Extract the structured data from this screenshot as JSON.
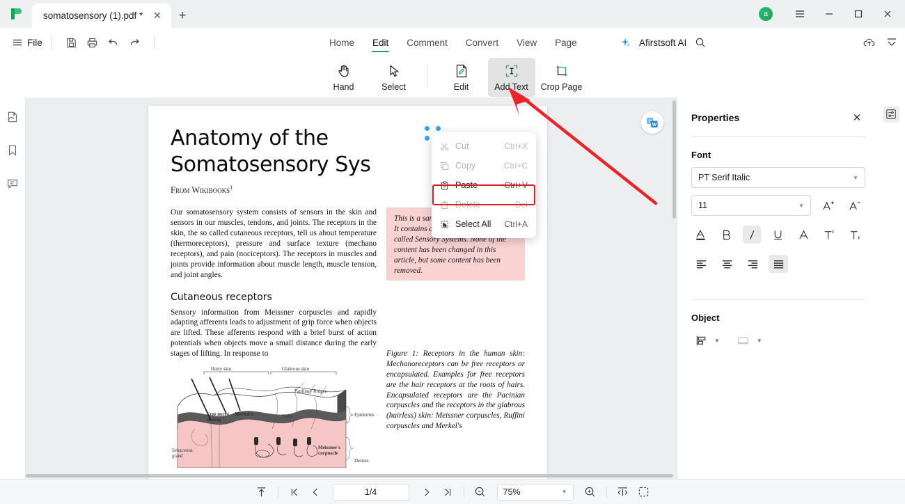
{
  "titlebar": {
    "tab_title": "somatosensory (1).pdf *",
    "close_label": "✕",
    "new_tab_label": "+",
    "avatar_initial": "a",
    "menu_label": "☰",
    "minimize_label": "—",
    "maximize_label": "☐",
    "close_window_label": "✕"
  },
  "ribbon": {
    "file_label": "File",
    "quick_actions": [
      "save-icon",
      "print-icon",
      "undo-icon",
      "redo-icon"
    ],
    "tabs": [
      {
        "label": "Home",
        "active": false
      },
      {
        "label": "Edit",
        "active": true
      },
      {
        "label": "Comment",
        "active": false
      },
      {
        "label": "Convert",
        "active": false
      },
      {
        "label": "View",
        "active": false
      },
      {
        "label": "Page",
        "active": false
      }
    ],
    "ai_label": "Afirstsoft AI",
    "tools": [
      {
        "label": "Hand",
        "icon": "hand-icon",
        "selected": false
      },
      {
        "label": "Select",
        "icon": "cursor-icon",
        "selected": false
      },
      {
        "label": "Edit",
        "icon": "edit-page-icon",
        "selected": false
      },
      {
        "label": "Add Text",
        "icon": "add-text-icon",
        "selected": true
      },
      {
        "label": "Crop Page",
        "icon": "crop-page-icon",
        "selected": false
      }
    ]
  },
  "left_rail": [
    {
      "name": "thumbnails-icon"
    },
    {
      "name": "bookmark-icon"
    },
    {
      "name": "comment-icon"
    }
  ],
  "document": {
    "title_line1": "Anatomy of the",
    "title_line2": "Somatosensory Sys",
    "from_label": "From Wikibooks",
    "from_sup": "1",
    "paragraph1": "Our somatosensory system consists of sensors in the skin and sensors in our muscles, tendons, and joints. The receptors in the skin, the so called cutaneous receptors, tell us about temperature (thermoreceptors), pressure and surface texture (mechano receptors), and pain (nociceptors). The receptors in muscles and joints provide information about muscle length, muscle tension, and joint angles.",
    "section_heading": "Cutaneous receptors",
    "paragraph2": "Sensory information from Meissner corpuscles and rapidly adapting afferents leads to adjustment of grip force when objects are lifted. These afferents respond with a brief burst of action potentials when objects move a small distance during the early stages of lifting. In response to",
    "pink_note": "This is a sample document showcasing. It contains a chapter from a Wikibook called Sensory Systems. None of the content has been changed in this article, but some content has been removed.",
    "figure_caption": "Figure 1:  Receptors in the human skin: Mechanoreceptors can be free receptors or encapsulated. Examples for free receptors are the hair receptors at the roots of hairs. Encapsulated receptors are the Pacinian corpuscles and the receptors in the glabrous (hairless) skin: Meissner corpuscles, Ruffini corpuscles and Merkel's",
    "figure_labels": {
      "hairy_skin": "Hairy skin",
      "glabrous_skin": "Glabrous skin",
      "papillary_ridges": "Papillary Ridges",
      "septa": "Septa",
      "epidermis": "Epidermis",
      "dermis": "Dermis",
      "free_nerve_ending": "Free nerve ending",
      "merkel": "Merkel's",
      "meissner": "Meissner's corpuscle",
      "sebaceous": "Sebaceous gland"
    }
  },
  "context_menu": {
    "items": [
      {
        "label": "Cut",
        "shortcut": "Ctrl+X",
        "icon": "scissors-icon",
        "disabled": true,
        "highlighted": false
      },
      {
        "label": "Copy",
        "shortcut": "Ctrl+C",
        "icon": "copy-icon",
        "disabled": true,
        "highlighted": false
      },
      {
        "label": "Paste",
        "shortcut": "Ctrl+V",
        "icon": "clipboard-icon",
        "disabled": false,
        "highlighted": true
      },
      {
        "label": "Delete",
        "shortcut": "Del",
        "icon": "trash-icon",
        "disabled": true,
        "highlighted": false
      },
      {
        "label": "Select All",
        "shortcut": "Ctrl+A",
        "icon": "select-all-icon",
        "disabled": false,
        "highlighted": false
      }
    ],
    "highlight_color": "#d81f1f"
  },
  "annotation": {
    "arrow_color": "#e8232a"
  },
  "properties": {
    "title": "Properties",
    "close_label": "✕",
    "font_section_label": "Font",
    "font_family_value": "PT Serif Italic",
    "font_size_value": "11",
    "format_buttons": [
      {
        "name": "font-color-icon",
        "label": "A",
        "active": false
      },
      {
        "name": "bold-icon",
        "label": "B",
        "active": false
      },
      {
        "name": "italic-icon",
        "label": "I",
        "active": true
      },
      {
        "name": "underline-icon",
        "label": "U",
        "active": false
      },
      {
        "name": "strikethrough-icon",
        "label": "A",
        "active": false
      },
      {
        "name": "superscript-icon",
        "label": "T'",
        "active": false
      },
      {
        "name": "subscript-icon",
        "label": "T,",
        "active": false
      }
    ],
    "align_buttons": [
      {
        "name": "align-left-icon",
        "active": false
      },
      {
        "name": "align-center-icon",
        "active": false
      },
      {
        "name": "align-right-icon",
        "active": false
      },
      {
        "name": "align-justify-icon",
        "active": true
      }
    ],
    "object_section_label": "Object",
    "object_buttons": [
      {
        "name": "align-objects-icon"
      },
      {
        "name": "object-fill-icon"
      }
    ]
  },
  "bottom_bar": {
    "page_value": "1/4",
    "zoom_value": "75%",
    "buttons": [
      "scroll-to-top-icon",
      "first-page-icon",
      "prev-page-icon",
      "next-page-icon",
      "last-page-icon",
      "zoom-out-icon",
      "zoom-in-icon",
      "fit-width-icon",
      "fit-page-icon"
    ]
  }
}
